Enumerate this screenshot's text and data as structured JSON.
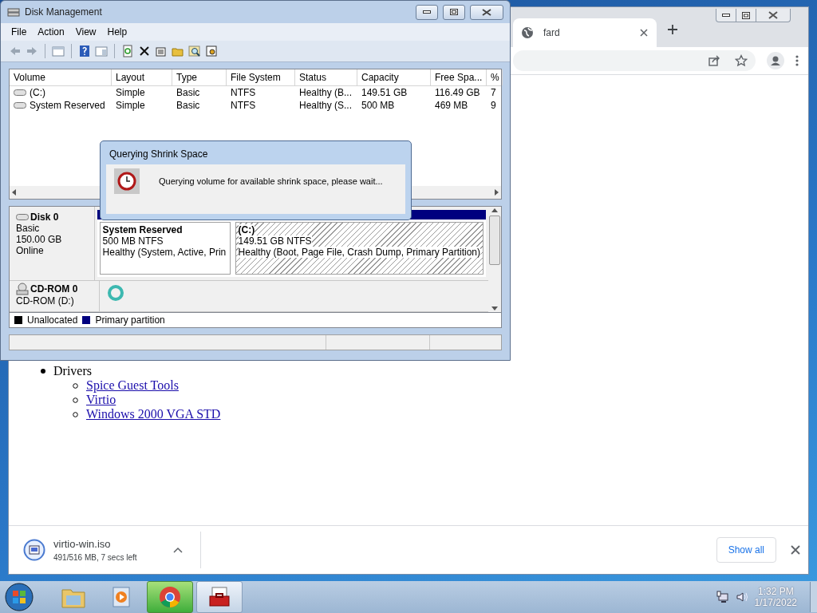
{
  "disk_management": {
    "title": "Disk Management",
    "menu": [
      "File",
      "Action",
      "View",
      "Help"
    ],
    "volume_table": {
      "columns": [
        "Volume",
        "Layout",
        "Type",
        "File System",
        "Status",
        "Capacity",
        "Free Spa...",
        "%"
      ],
      "rows": [
        [
          "(C:)",
          "Simple",
          "Basic",
          "NTFS",
          "Healthy (B...",
          "149.51 GB",
          "116.49 GB",
          "7"
        ],
        [
          "System Reserved",
          "Simple",
          "Basic",
          "NTFS",
          "Healthy (S...",
          "500 MB",
          "469 MB",
          "9"
        ]
      ]
    },
    "disks": [
      {
        "kind": "disk",
        "name": "Disk 0",
        "lines": [
          "Basic",
          "150.00 GB",
          "Online"
        ],
        "partitions": [
          {
            "name": "System Reserved",
            "size": "500 MB NTFS",
            "status": "Healthy (System, Active, Prin",
            "selected": false
          },
          {
            "name": "(C:)",
            "size": "149.51 GB NTFS",
            "status": "Healthy (Boot, Page File, Crash Dump, Primary Partition)",
            "selected": true
          }
        ]
      },
      {
        "kind": "cdrom",
        "name": "CD-ROM 0",
        "lines": [
          "CD-ROM (D:)"
        ]
      }
    ],
    "legend": [
      {
        "label": "Unallocated",
        "color": "#000000"
      },
      {
        "label": "Primary partition",
        "color": "#00007f"
      }
    ],
    "dialog": {
      "title": "Querying Shrink Space",
      "message": "Querying volume for available shrink space, please wait..."
    }
  },
  "browser": {
    "tab": {
      "title": "fard"
    },
    "page": {
      "list": [
        {
          "text": "Drivers",
          "children": [
            {
              "text": "Spice Guest Tools"
            },
            {
              "text": "Virtio"
            },
            {
              "text": "Windows 2000 VGA STD"
            }
          ]
        }
      ]
    },
    "download": {
      "file": "virtio-win.iso",
      "status": "491/516 MB, 7 secs left"
    },
    "show_all": "Show all"
  },
  "taskbar": {
    "time": "1:32 PM",
    "date": "1/17/2022"
  }
}
